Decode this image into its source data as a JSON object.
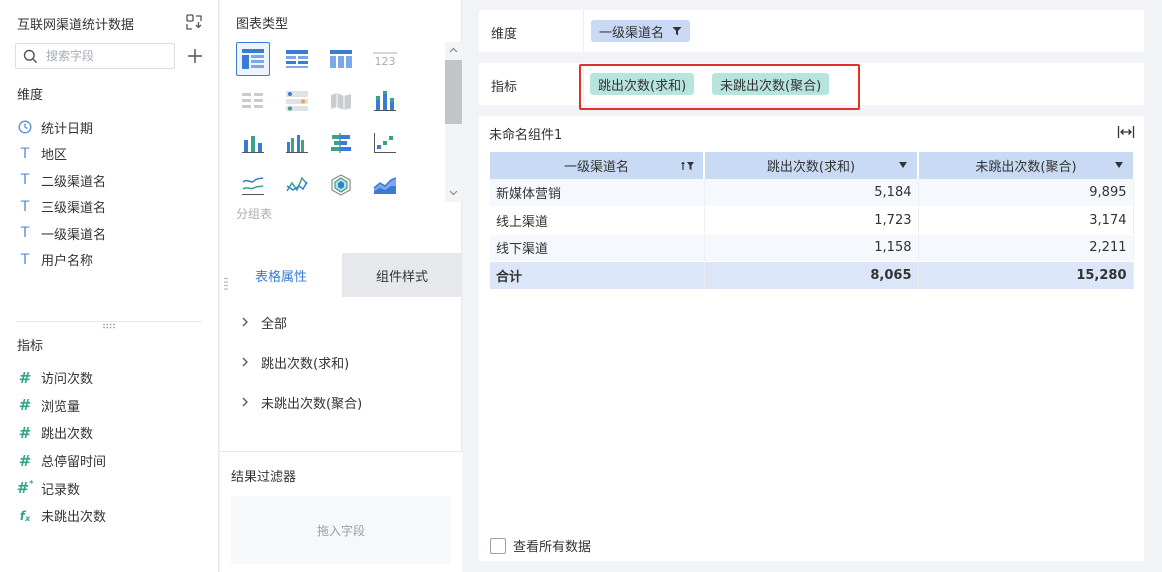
{
  "datasource": {
    "title": "互联网渠道统计数据"
  },
  "search": {
    "placeholder": "搜索字段"
  },
  "dimensions": {
    "label": "维度",
    "items": [
      {
        "label": "统计日期",
        "icon": "clock-icon"
      },
      {
        "label": "地区",
        "icon": "text-field-icon"
      },
      {
        "label": "二级渠道名",
        "icon": "text-field-icon"
      },
      {
        "label": "三级渠道名",
        "icon": "text-field-icon"
      },
      {
        "label": "一级渠道名",
        "icon": "text-field-icon"
      },
      {
        "label": "用户名称",
        "icon": "text-field-icon"
      }
    ]
  },
  "measures": {
    "label": "指标",
    "items": [
      {
        "label": "访问次数",
        "icon": "hash-icon"
      },
      {
        "label": "浏览量",
        "icon": "hash-icon"
      },
      {
        "label": "跳出次数",
        "icon": "hash-icon"
      },
      {
        "label": "总停留时间",
        "icon": "hash-icon"
      },
      {
        "label": "记录数",
        "icon": "hash-star-icon"
      },
      {
        "label": "未跳出次数",
        "icon": "formula-icon"
      }
    ]
  },
  "chart_types": {
    "title": "图表类型",
    "group_label": "分组表",
    "selected": "group-table",
    "icons": [
      "group-table-icon",
      "detail-table-icon",
      "cross-table-icon",
      "kpi-number-icon",
      "text-grid-icon",
      "dot-matrix-icon",
      "map-icon",
      "stacked-bar-icon",
      "column-chart-icon",
      "grouped-column-icon",
      "horizontal-bar-icon",
      "scatter-icon",
      "line-chart-icon",
      "radar-chart-icon",
      "hexagon-chart-icon",
      "area-chart-icon"
    ]
  },
  "tabs": {
    "table_props": "表格属性",
    "component_style": "组件样式"
  },
  "properties": [
    {
      "label": "全部"
    },
    {
      "label": "跳出次数(求和)"
    },
    {
      "label": "未跳出次数(聚合)"
    }
  ],
  "result_filter": {
    "title": "结果过滤器",
    "placeholder": "拖入字段"
  },
  "dimension_row": {
    "label": "维度",
    "pills": [
      "一级渠道名"
    ]
  },
  "measure_row": {
    "label": "指标",
    "pills": [
      "跳出次数(求和)",
      "未跳出次数(聚合)"
    ]
  },
  "highlight_color": "#e0312b",
  "widget": {
    "title": "未命名组件1",
    "columns": [
      "一级渠道名",
      "跳出次数(求和)",
      "未跳出次数(聚合)"
    ],
    "rows": [
      {
        "name": "新媒体营销",
        "bounce": "5,184",
        "no_bounce": "9,895"
      },
      {
        "name": "线上渠道",
        "bounce": "1,723",
        "no_bounce": "3,174"
      },
      {
        "name": "线下渠道",
        "bounce": "1,158",
        "no_bounce": "2,211"
      }
    ],
    "total": {
      "name": "合计",
      "bounce": "8,065",
      "no_bounce": "15,280"
    },
    "view_all_label": "查看所有数据"
  }
}
